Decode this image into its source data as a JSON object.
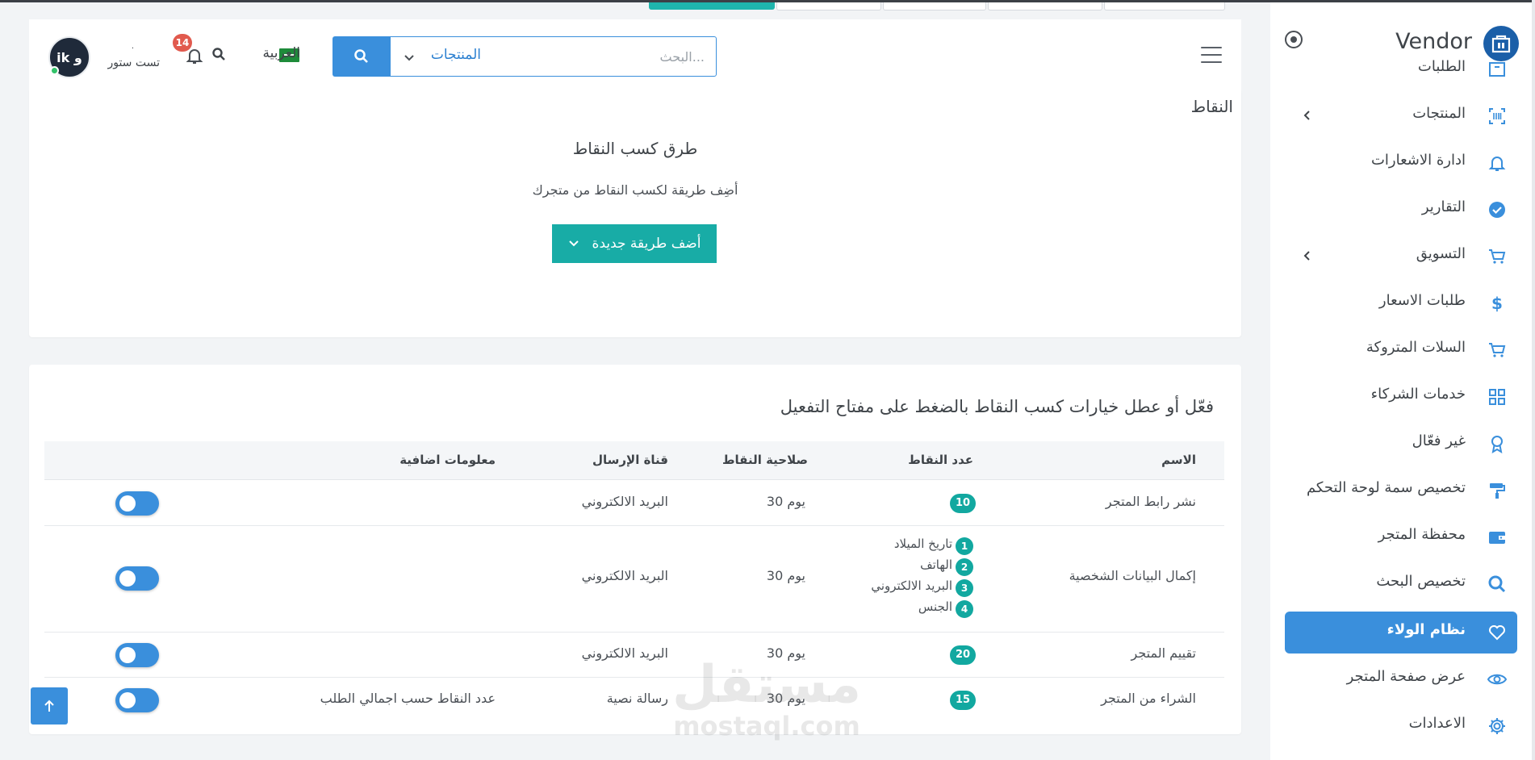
{
  "sidebar": {
    "brand": "Vendor",
    "items": [
      {
        "label": "الطلبات",
        "icon": "archive-box-icon"
      },
      {
        "label": "المنتجات",
        "icon": "barcode-icon",
        "expandable": true
      },
      {
        "label": "ادارة الاشعارات",
        "icon": "bell-icon"
      },
      {
        "label": "التقارير",
        "icon": "check-circle-icon"
      },
      {
        "label": "التسويق",
        "icon": "cart-icon",
        "expandable": true
      },
      {
        "label": "طلبات الاسعار",
        "icon": "dollar-icon"
      },
      {
        "label": "السلات المتروكة",
        "icon": "cart-icon"
      },
      {
        "label": "خدمات الشركاء",
        "icon": "grid-icon"
      },
      {
        "label": "غير فعّال",
        "icon": "award-icon"
      },
      {
        "label": "تخصيص سمة لوحة التحكم",
        "icon": "paint-roller-icon"
      },
      {
        "label": "محفظة المتجر",
        "icon": "wallet-icon"
      },
      {
        "label": "تخصيص البحث",
        "icon": "search-icon"
      },
      {
        "label": "نظام الولاء",
        "icon": "heart-icon",
        "active": true
      },
      {
        "label": "عرض صفحة المتجر",
        "icon": "eye-icon"
      },
      {
        "label": "الاعدادات",
        "icon": "gear-icon"
      }
    ]
  },
  "header": {
    "search": {
      "placeholder": "البحث...",
      "category": "المنتجات"
    },
    "language": "العربية",
    "notifications_count": "14",
    "store": {
      "name": "تست ستور",
      "subtitle": "."
    },
    "avatar_text": "ik و"
  },
  "colors": {
    "primary": "#3a8fdc",
    "teal": "#18aca6",
    "badge": "#e15a4e"
  },
  "points_section": {
    "title": "النقاط",
    "ways_title": "طرق كسب النقاط",
    "ways_subtitle": "أضِف طريقة لكسب النقاط من متجرك",
    "add_button": "أضف طريقة جديدة"
  },
  "rules_section": {
    "title": "فعّل أو عطل خيارات كسب النقاط بالضغط على مفتاح التفعيل",
    "columns": [
      "الاسم",
      "عدد النقاط",
      "صلاحية النقاط",
      "قناة الإرسال",
      "معلومات اضافية"
    ],
    "rows": [
      {
        "name": "نشر رابط المتجر",
        "points": "10",
        "validity": "30 يوم",
        "channel": "البريد الالكتروني",
        "extra": "",
        "enabled": true
      },
      {
        "name": "إكمال البيانات الشخصية",
        "points_list": [
          {
            "n": "1",
            "label": "تاريخ الميلاد"
          },
          {
            "n": "2",
            "label": "الهاتف"
          },
          {
            "n": "3",
            "label": "البريد الالكتروني"
          },
          {
            "n": "4",
            "label": "الجنس"
          }
        ],
        "validity": "30 يوم",
        "channel": "البريد الالكتروني",
        "extra": "",
        "enabled": true
      },
      {
        "name": "تقييم المتجر",
        "points": "20",
        "validity": "30 يوم",
        "channel": "البريد الالكتروني",
        "extra": "",
        "enabled": true
      },
      {
        "name": "الشراء من المتجر",
        "points": "15",
        "validity": "30 يوم",
        "channel": "رسالة نصية",
        "extra": "عدد النقاط حسب اجمالي الطلب",
        "enabled": true
      }
    ]
  },
  "watermark": {
    "ar": "مستقل",
    "en": "mostaql.com"
  }
}
